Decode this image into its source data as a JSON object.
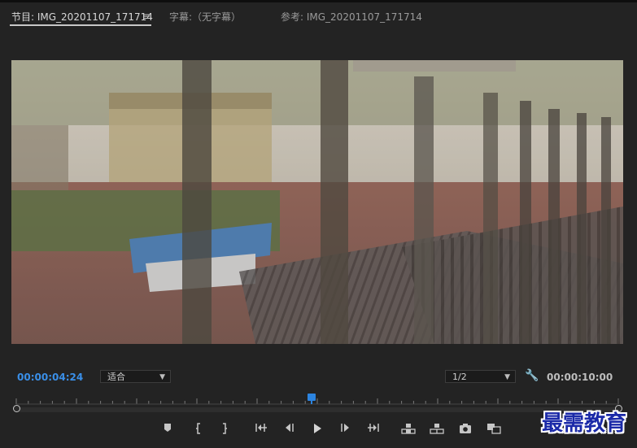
{
  "tabs": {
    "program": "节目: IMG_20201107_171714",
    "menu_glyph": "≡",
    "captions": "字幕:（无字幕）",
    "reference": "参考: IMG_20201107_171714"
  },
  "transport": {
    "current_timecode": "00:00:04:24",
    "fit_label": "适合",
    "resolution_label": "1/2",
    "duration_timecode": "00:00:10:00"
  },
  "buttons": [
    "add-marker",
    "mark-in",
    "mark-out",
    "go-to-in",
    "step-back",
    "play",
    "step-forward",
    "go-to-out",
    "lift",
    "extract",
    "export-frame",
    "comparison-view"
  ],
  "watermark": {
    "text": "最需教育"
  },
  "colors": {
    "accent": "#2c84e0",
    "background": "#232323"
  }
}
